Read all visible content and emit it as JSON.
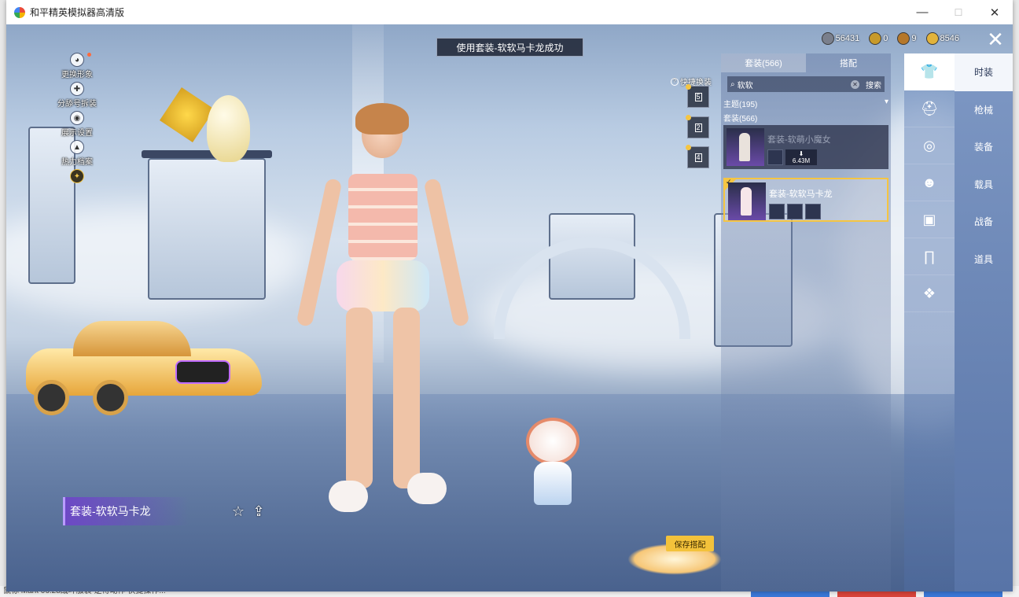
{
  "window": {
    "title": "和平精英模拟器高清版",
    "controls": {
      "minimize": "—",
      "maximize": "☐",
      "close": "✕"
    }
  },
  "toast": "使用套装-软软马卡龙成功",
  "left_menu": [
    {
      "label": "更换形象",
      "icon": "avatar-icon"
    },
    {
      "label": "分舔号拆装",
      "icon": "dismantle-icon"
    },
    {
      "label": "展示设置",
      "icon": "eye-icon"
    },
    {
      "label": "热力档案",
      "icon": "fire-icon"
    },
    {
      "label": "",
      "icon": "badge-icon"
    }
  ],
  "currency": [
    {
      "icon": "silver-coin-icon",
      "value": "56431",
      "color": "#7a7f8c"
    },
    {
      "icon": "gold-token-icon",
      "value": "0",
      "color": "#c89a2a"
    },
    {
      "icon": "bronze-token-icon",
      "value": "9",
      "color": "#b5772a"
    },
    {
      "icon": "gold-coin-icon",
      "value": "8546",
      "color": "#e2b33b"
    }
  ],
  "close_button": "✕",
  "panel": {
    "tabs": [
      {
        "label": "套装(566)",
        "active": true
      },
      {
        "label": "搭配",
        "active": false
      }
    ],
    "search": {
      "value": "软软",
      "button": "搜索"
    },
    "filter_theme": "主题(195)",
    "filter_suit": "套装(566)",
    "cards": [
      {
        "title": "套装-软萌小魔女",
        "download_size": "6.43M",
        "equipped": false
      },
      {
        "title": "套装-软软马卡龙",
        "equipped": true
      }
    ]
  },
  "quick_switch": {
    "label": "快捷换装",
    "slots": [
      "5",
      "2",
      "4"
    ]
  },
  "category_icons": [
    "outfit-icon",
    "hat-icon",
    "glasses-icon",
    "mask-icon",
    "top-icon",
    "pants-icon",
    "accessory-icon"
  ],
  "tabs": [
    {
      "label": "时装",
      "active": true
    },
    {
      "label": "枪械",
      "active": false
    },
    {
      "label": "装备",
      "active": false
    },
    {
      "label": "载具",
      "active": false
    },
    {
      "label": "战备",
      "active": false
    },
    {
      "label": "道具",
      "active": false
    }
  ],
  "outfit_name": "套装-软软马卡龙",
  "save_button": "保存搭配",
  "taskbar_text": "鼠标 Mark 06.28战斗服装 逆得动作 快捷操作..."
}
